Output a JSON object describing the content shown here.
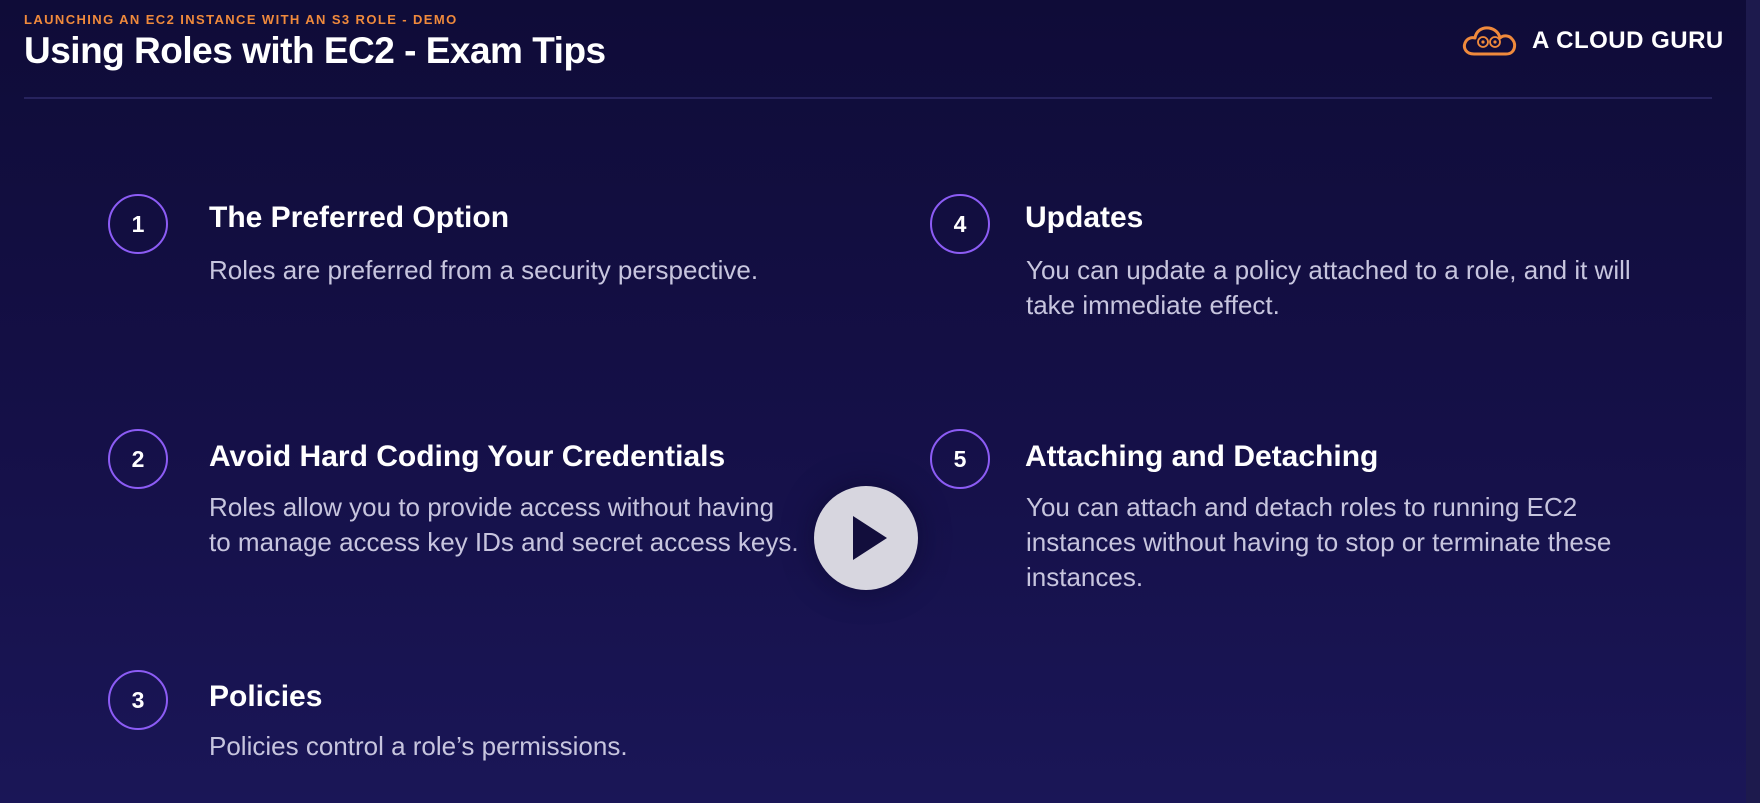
{
  "header": {
    "eyebrow": "LAUNCHING AN EC2 INSTANCE WITH AN S3 ROLE - DEMO",
    "title": "Using Roles with EC2 - Exam Tips"
  },
  "brand": {
    "name": "A CLOUD GURU",
    "icon": "cloud-logo-icon"
  },
  "tips": [
    {
      "number": "1",
      "heading": "The Preferred Option",
      "body": "Roles are preferred from a security perspective."
    },
    {
      "number": "2",
      "heading": "Avoid Hard Coding Your Credentials",
      "body": "Roles allow you to provide access without having to manage access key IDs and secret access keys."
    },
    {
      "number": "3",
      "heading": "Policies",
      "body": "Policies control a role’s permissions."
    },
    {
      "number": "4",
      "heading": "Updates",
      "body": "You can update a policy attached to a role, and it will take immediate effect."
    },
    {
      "number": "5",
      "heading": "Attaching and Detaching",
      "body": "You can attach and detach roles to running EC2 instances without having to stop or terminate these instances."
    }
  ],
  "player": {
    "play_icon": "play-icon"
  },
  "colors": {
    "accent": "#f08a3c",
    "circle_border": "#8c5cf5",
    "background": "#140f45"
  }
}
